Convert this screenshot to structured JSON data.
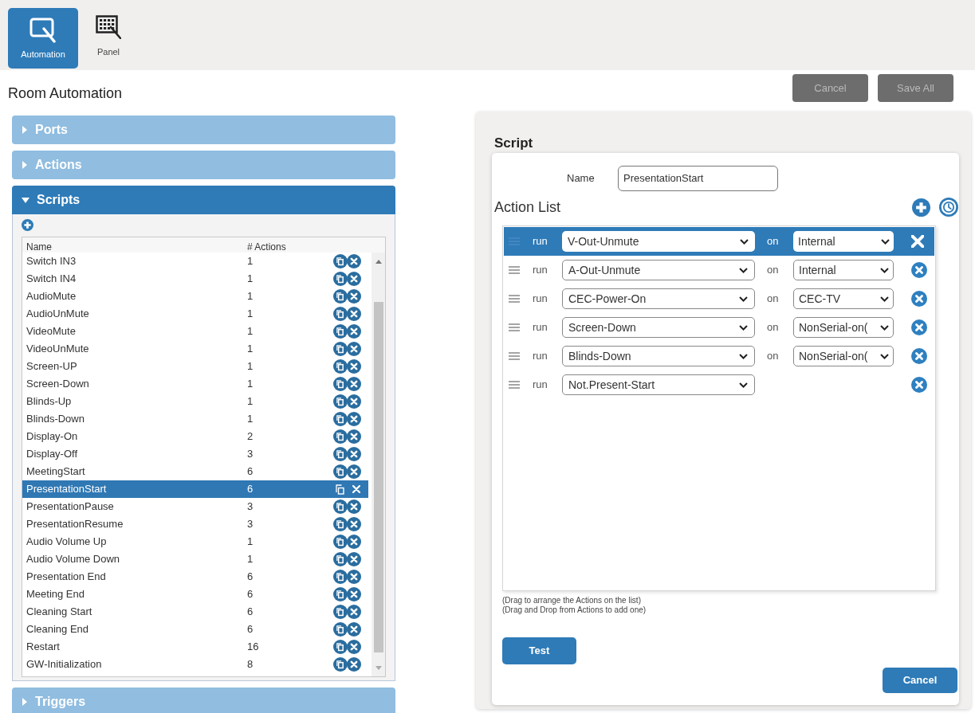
{
  "toolbar": {
    "tabs": [
      {
        "label": "Automation",
        "selected": true
      },
      {
        "label": "Panel",
        "selected": false
      }
    ]
  },
  "header": {
    "title": "Room Automation",
    "buttons": [
      {
        "label": "Cancel",
        "disabled": true
      },
      {
        "label": "Save All",
        "disabled": true
      }
    ]
  },
  "sections": [
    {
      "title": "Ports",
      "expanded": false
    },
    {
      "title": "Actions",
      "expanded": false
    },
    {
      "title": "Scripts",
      "expanded": true,
      "table": {
        "columns": [
          "Name",
          "# Actions"
        ],
        "rows": [
          {
            "name": "Switch IN3",
            "actions": "1",
            "selected": false
          },
          {
            "name": "Switch IN4",
            "actions": "1",
            "selected": false
          },
          {
            "name": "AudioMute",
            "actions": "1",
            "selected": false
          },
          {
            "name": "AudioUnMute",
            "actions": "1",
            "selected": false
          },
          {
            "name": "VideoMute",
            "actions": "1",
            "selected": false
          },
          {
            "name": "VideoUnMute",
            "actions": "1",
            "selected": false
          },
          {
            "name": "Screen-UP",
            "actions": "1",
            "selected": false
          },
          {
            "name": "Screen-Down",
            "actions": "1",
            "selected": false
          },
          {
            "name": "Blinds-Up",
            "actions": "1",
            "selected": false
          },
          {
            "name": "Blinds-Down",
            "actions": "1",
            "selected": false
          },
          {
            "name": "Display-On",
            "actions": "2",
            "selected": false
          },
          {
            "name": "Display-Off",
            "actions": "3",
            "selected": false
          },
          {
            "name": "MeetingStart",
            "actions": "6",
            "selected": false
          },
          {
            "name": "PresentationStart",
            "actions": "6",
            "selected": true
          },
          {
            "name": "PresentationPause",
            "actions": "3",
            "selected": false
          },
          {
            "name": "PresentationResume",
            "actions": "3",
            "selected": false
          },
          {
            "name": "Audio Volume Up",
            "actions": "1",
            "selected": false
          },
          {
            "name": "Audio Volume Down",
            "actions": "1",
            "selected": false
          },
          {
            "name": "Presentation End",
            "actions": "6",
            "selected": false
          },
          {
            "name": "Meeting End",
            "actions": "6",
            "selected": false
          },
          {
            "name": "Cleaning Start",
            "actions": "6",
            "selected": false
          },
          {
            "name": "Cleaning End",
            "actions": "6",
            "selected": false
          },
          {
            "name": "Restart",
            "actions": "16",
            "selected": false
          },
          {
            "name": "GW-Initialization",
            "actions": "8",
            "selected": false
          }
        ]
      }
    },
    {
      "title": "Triggers",
      "expanded": false
    }
  ],
  "script_editor": {
    "title": "Script",
    "name_label": "Name",
    "name_value": "PresentationStart",
    "list_title": "Action List",
    "actions": [
      {
        "selected": true,
        "keyword": "run",
        "action": "V-Out-Unmute",
        "connector": "on",
        "target": "Internal"
      },
      {
        "selected": false,
        "keyword": "run",
        "action": "A-Out-Unmute",
        "connector": "on",
        "target": "Internal"
      },
      {
        "selected": false,
        "keyword": "run",
        "action": "CEC-Power-On",
        "connector": "on",
        "target": "CEC-TV"
      },
      {
        "selected": false,
        "keyword": "run",
        "action": "Screen-Down",
        "connector": "on",
        "target": "NonSerial-on("
      },
      {
        "selected": false,
        "keyword": "run",
        "action": "Blinds-Down",
        "connector": "on",
        "target": "NonSerial-on("
      },
      {
        "selected": false,
        "keyword": "run",
        "action": "Not.Present-Start"
      }
    ],
    "hints": [
      "(Drag to arrange the Actions on the list)",
      "(Drag and Drop from Actions to add one)"
    ],
    "test_button": "Test",
    "cancel_button": "Cancel"
  }
}
